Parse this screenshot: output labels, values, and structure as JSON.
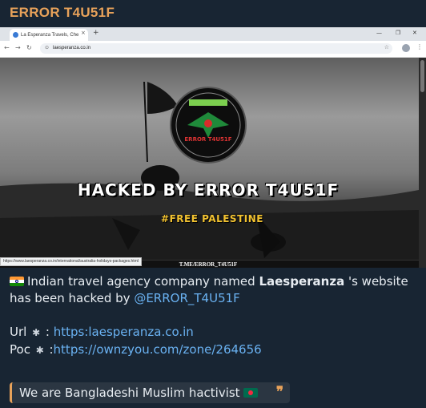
{
  "message": {
    "sender": "ERROR T4U51F",
    "accent_color": "#e8a25a",
    "link_color": "#6ab2f2",
    "caption": {
      "line1_flag": "india-flag-icon",
      "line1_prefix": "Indian travel agency company named ",
      "company": "Laesperanza",
      "line1_suffix": " 's website",
      "line2_prefix": "has been hacked by ",
      "mention": "@ERROR_T4U51F",
      "url_label": "Url",
      "url_colon": " : ",
      "url_value": "https:laesperanza.co.in",
      "poc_label": "Poc",
      "poc_colon": " :",
      "poc_value": "https://ownzyou.com/zone/264656"
    },
    "quote": {
      "text": "We are Bangladeshi Muslim hactivist",
      "flag": "bangladesh-flag-icon",
      "mark": "❞"
    }
  },
  "screenshot": {
    "browser": {
      "tab_title": "La Esperanza Travels, Cheap Ai",
      "url": "laesperanza.co.in",
      "status_url": "https://www.laesperanza.co.in/international/australia-holidays-packages.html"
    },
    "defacement": {
      "logo_text": "ERROR T4U51F",
      "headline": "HACKED BY ERROR T4U51F",
      "subline": "#FREE PALESTINE",
      "footer": "T.ME/ERROR_T4U51F"
    }
  }
}
